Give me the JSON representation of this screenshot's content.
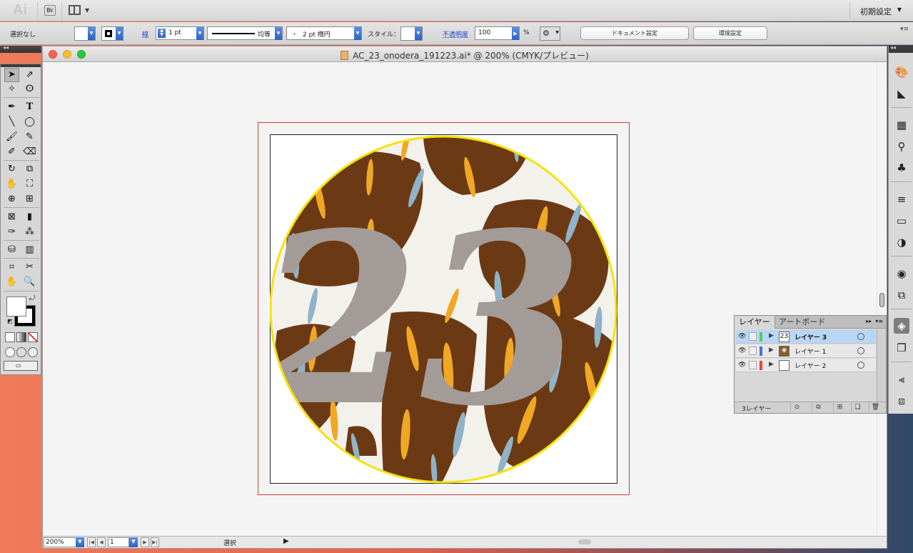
{
  "app": {
    "logo_text": "Ai",
    "bridge_label": "Br",
    "workspace": "初期設定"
  },
  "control_bar": {
    "selection_label": "選択なし",
    "stroke_label": "線",
    "stroke_weight": "1 pt",
    "stroke_profile": "均等",
    "brush": "2 pt 楕円",
    "brush_dot": "・",
    "style_label": "スタイル：",
    "opacity_label": "不透明度",
    "opacity_value": "100",
    "opacity_unit": "%",
    "document_setup_button": "ドキュメント設定",
    "preferences_button": "環境設定"
  },
  "document": {
    "title": "AC_23_onodera_191223.ai* @ 200% (CMYK/プレビュー)",
    "zoom": "200%",
    "artboard_number": "1",
    "status": "選択"
  },
  "artwork": {
    "number_text": "23",
    "circle_stroke": "#f5e30a",
    "number_color": "#a39b97",
    "leaf_brown": "#6b3a14",
    "leaf_orange": "#f0a824",
    "leaf_blue": "#8fb3c8"
  },
  "layers_panel": {
    "tabs": [
      "レイヤー",
      "アートボード"
    ],
    "layers": [
      {
        "name": "レイヤー 3",
        "color": "#4fd04f",
        "selected": true
      },
      {
        "name": "レイヤー 1",
        "color": "#4a6ee0",
        "selected": false
      },
      {
        "name": "レイヤー 2",
        "color": "#e24848",
        "selected": false
      }
    ],
    "count_label": "3レイヤー"
  },
  "icons": {
    "tools": [
      "selection-tool-icon",
      "direct-selection-tool-icon",
      "magic-wand-icon",
      "lasso-icon",
      "pen-tool-icon",
      "type-tool-icon",
      "line-tool-icon",
      "ellipse-tool-icon",
      "paintbrush-icon",
      "pencil-icon",
      "blob-brush-icon",
      "eraser-icon",
      "rotate-tool-icon",
      "scale-tool-icon",
      "warp-tool-icon",
      "free-transform-icon",
      "shape-builder-icon",
      "perspective-grid-icon",
      "mesh-tool-icon",
      "gradient-tool-icon",
      "eyedropper-icon",
      "blend-tool-icon",
      "symbol-sprayer-icon",
      "column-graph-icon",
      "artboard-tool-icon",
      "slice-tool-icon",
      "hand-tool-icon",
      "zoom-tool-icon"
    ]
  }
}
